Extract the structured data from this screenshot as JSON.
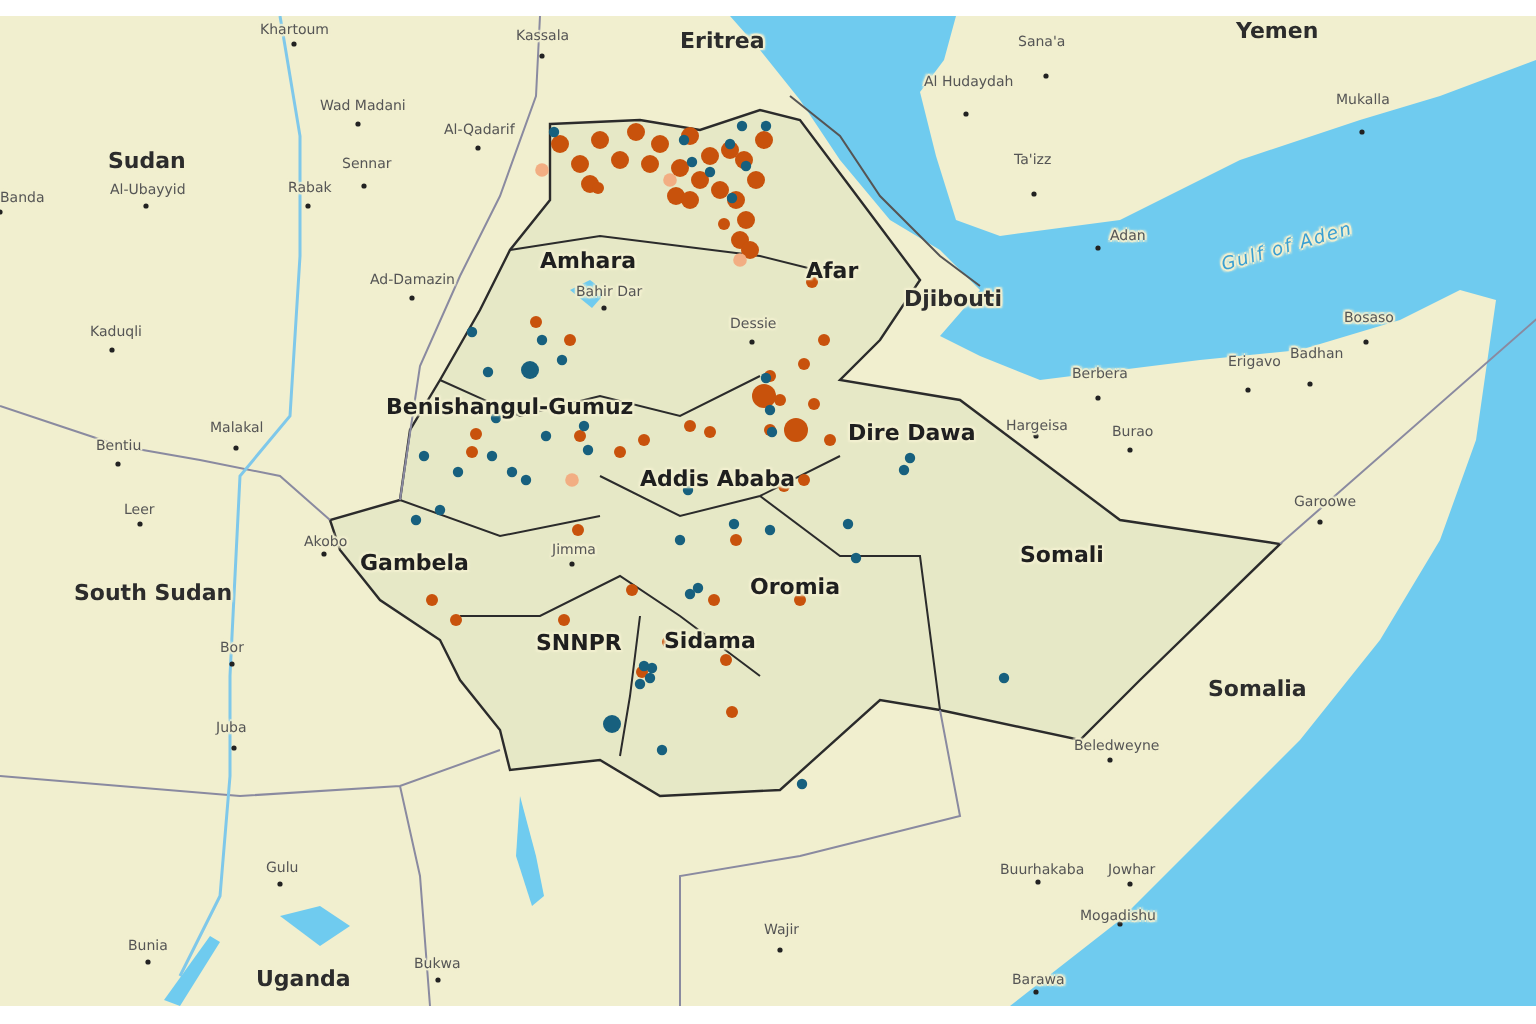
{
  "map": {
    "labels": [
      {
        "kind": "country",
        "text": "Sudan"
      },
      {
        "kind": "country",
        "text": "Eritrea"
      },
      {
        "kind": "country",
        "text": "Yemen"
      },
      {
        "kind": "country",
        "text": "Djibouti"
      },
      {
        "kind": "country",
        "text": "South Sudan"
      },
      {
        "kind": "country",
        "text": "Somalia"
      },
      {
        "kind": "country",
        "text": "Uganda"
      },
      {
        "kind": "region",
        "text": "Amhara"
      },
      {
        "kind": "region",
        "text": "Afar"
      },
      {
        "kind": "region",
        "text": "Benishangul-Gumuz"
      },
      {
        "kind": "region",
        "text": "Addis Ababa"
      },
      {
        "kind": "region",
        "text": "Dire Dawa"
      },
      {
        "kind": "region",
        "text": "Gambela"
      },
      {
        "kind": "region",
        "text": "SNNPR"
      },
      {
        "kind": "region",
        "text": "Sidama"
      },
      {
        "kind": "region",
        "text": "Oromia"
      },
      {
        "kind": "region",
        "text": "Somali"
      },
      {
        "kind": "city",
        "text": "Khartoum"
      },
      {
        "kind": "city",
        "text": "Kassala"
      },
      {
        "kind": "city",
        "text": "Wad Madani"
      },
      {
        "kind": "city",
        "text": "Al-Qadarif"
      },
      {
        "kind": "city",
        "text": "Sennar"
      },
      {
        "kind": "city",
        "text": "Rabak"
      },
      {
        "kind": "city",
        "text": "Banda"
      },
      {
        "kind": "city",
        "text": "Al-Ubayyid"
      },
      {
        "kind": "city",
        "text": "Ad-Damazin"
      },
      {
        "kind": "city",
        "text": "Bahir Dar"
      },
      {
        "kind": "city",
        "text": "Kaduqli"
      },
      {
        "kind": "city",
        "text": "Dessie"
      },
      {
        "kind": "city",
        "text": "Malakal"
      },
      {
        "kind": "city",
        "text": "Bentiu"
      },
      {
        "kind": "city",
        "text": "Leer"
      },
      {
        "kind": "city",
        "text": "Akobo"
      },
      {
        "kind": "city",
        "text": "Jimma"
      },
      {
        "kind": "city",
        "text": "Bor"
      },
      {
        "kind": "city",
        "text": "Juba"
      },
      {
        "kind": "city",
        "text": "Gulu"
      },
      {
        "kind": "city",
        "text": "Bunia"
      },
      {
        "kind": "city",
        "text": "Bukwa"
      },
      {
        "kind": "city",
        "text": "Wajir"
      },
      {
        "kind": "city",
        "text": "Sana'a"
      },
      {
        "kind": "city",
        "text": "Al Hudaydah"
      },
      {
        "kind": "city",
        "text": "Mukalla"
      },
      {
        "kind": "city",
        "text": "Ta'izz"
      },
      {
        "kind": "city",
        "text": "Adan"
      },
      {
        "kind": "city",
        "text": "Bosaso"
      },
      {
        "kind": "city",
        "text": "Berbera"
      },
      {
        "kind": "city",
        "text": "Erigavo"
      },
      {
        "kind": "city",
        "text": "Badhan"
      },
      {
        "kind": "city",
        "text": "Hargeisa"
      },
      {
        "kind": "city",
        "text": "Burao"
      },
      {
        "kind": "city",
        "text": "Garoowe"
      },
      {
        "kind": "city",
        "text": "Beledweyne"
      },
      {
        "kind": "city",
        "text": "Buurhakaba"
      },
      {
        "kind": "city",
        "text": "Jowhar"
      },
      {
        "kind": "city",
        "text": "Mogadishu"
      },
      {
        "kind": "city",
        "text": "Barawa"
      },
      {
        "kind": "water",
        "text": "Gulf of Aden"
      }
    ]
  }
}
